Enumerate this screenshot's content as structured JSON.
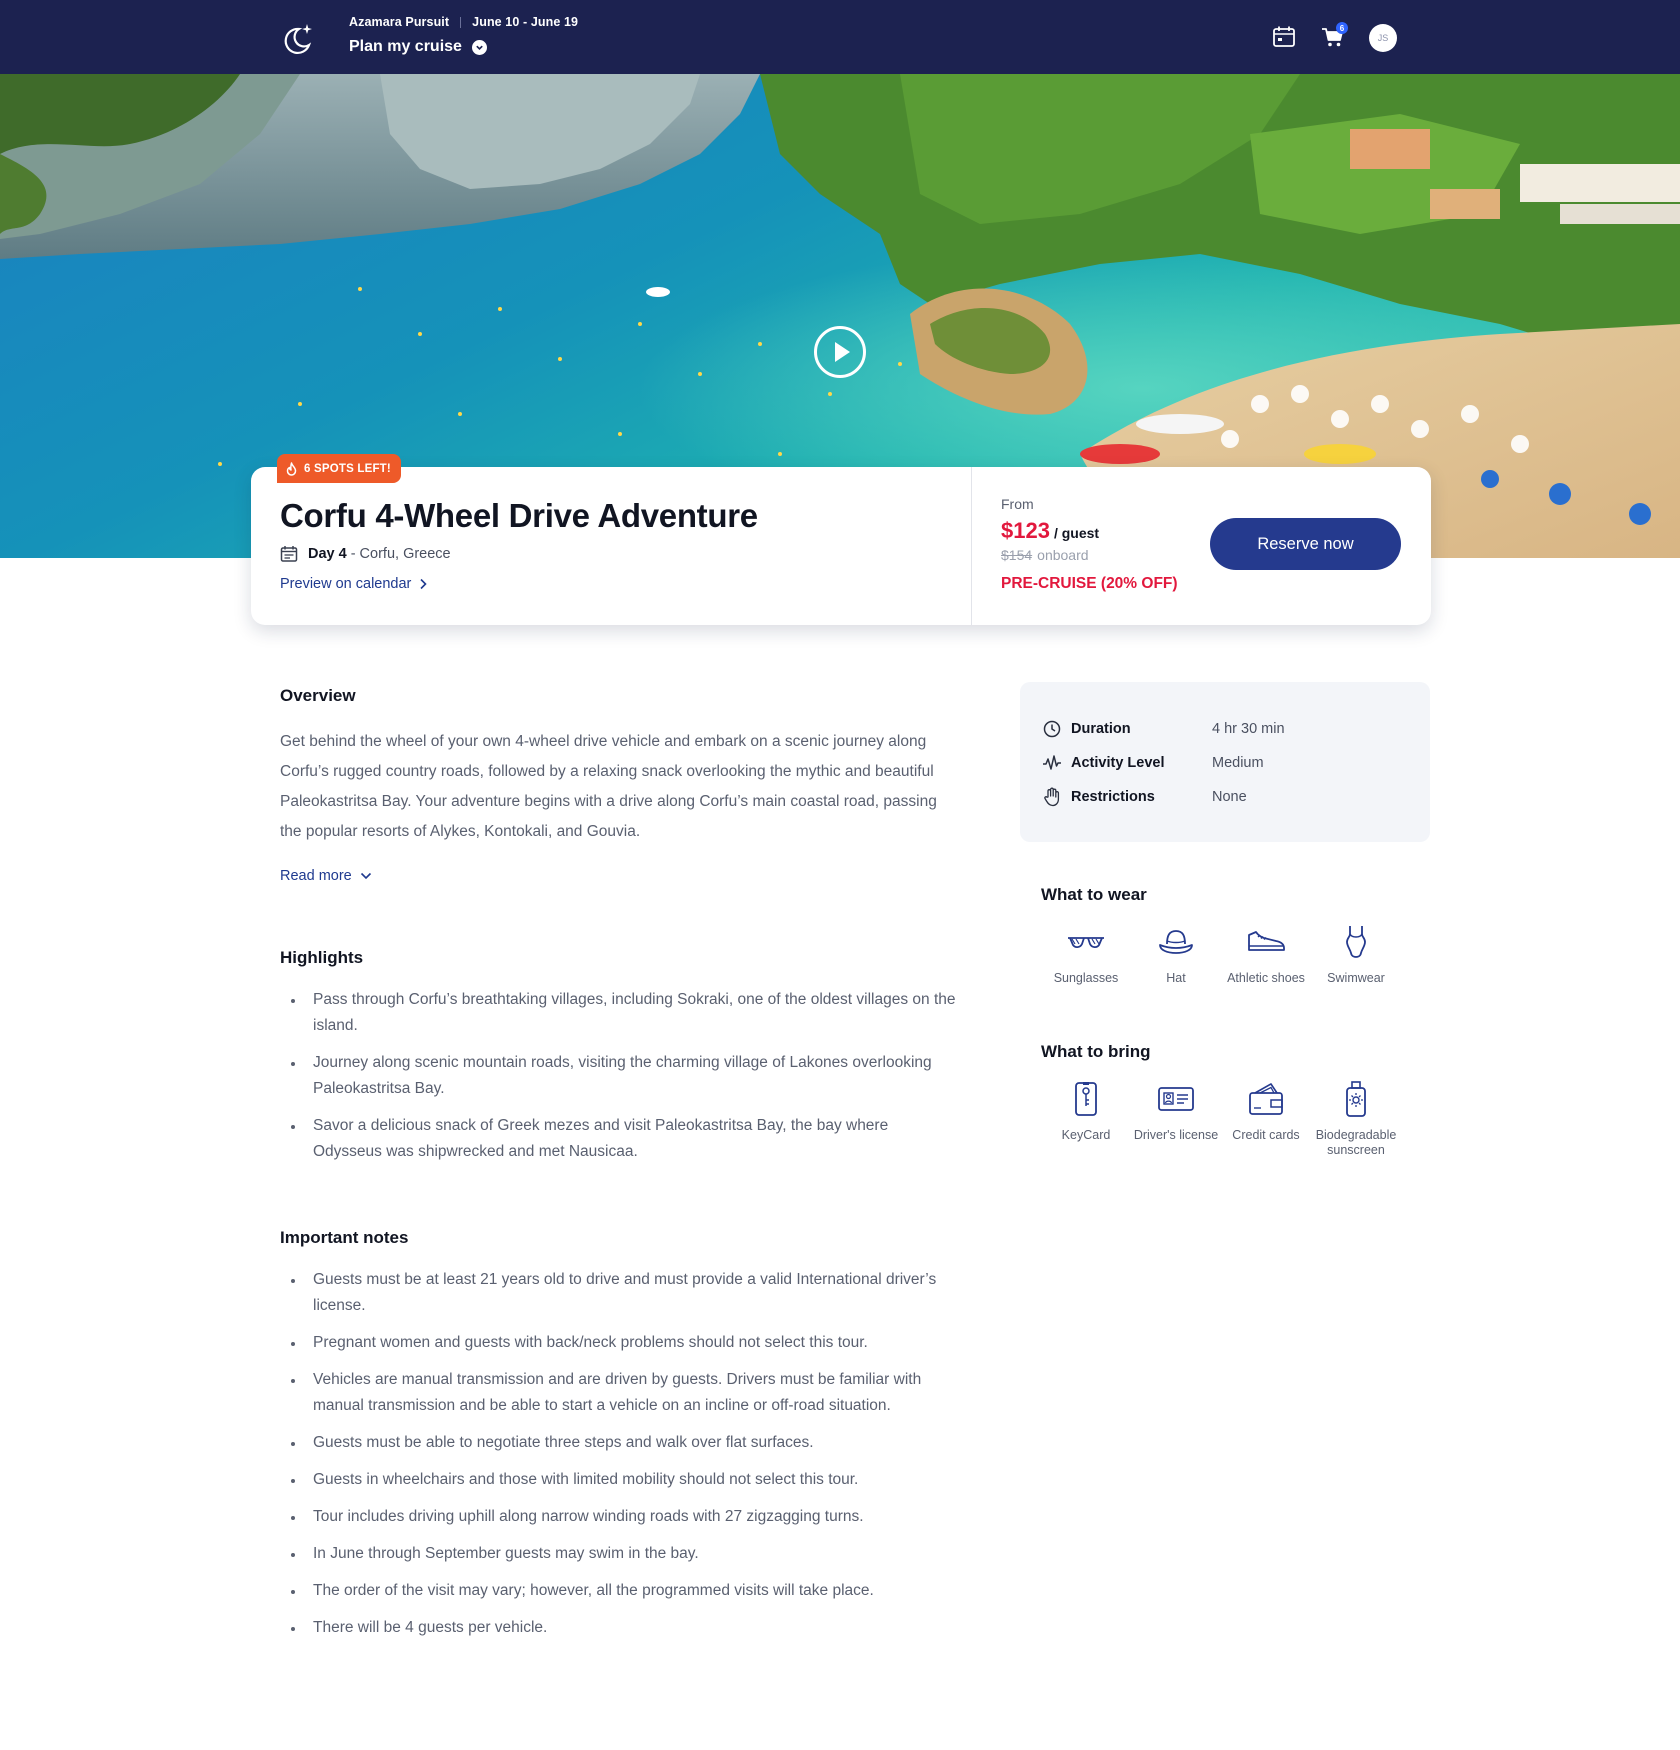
{
  "header": {
    "ship_name": "Azamara Pursuit",
    "dates": "June 10  - June 19",
    "plan_label": "Plan my cruise",
    "cart_count": "6",
    "avatar_initials": "JS",
    "bg_color": "#1c2250"
  },
  "badge": {
    "spots_left": "6 SPOTS LEFT!",
    "color": "#ee5a29"
  },
  "excursion": {
    "title": "Corfu 4-Wheel Drive Adventure",
    "day": "Day 4",
    "location": "- Corfu, Greece",
    "calendar_link": "Preview on calendar"
  },
  "pricing": {
    "from_label": "From",
    "price": "$123",
    "unit": "/ guest",
    "old_price": "$154",
    "old_price_suffix": "onboard",
    "promo": "PRE-CRUISE (20% OFF)",
    "reserve_label": "Reserve now",
    "accent_color": "#e2183d",
    "button_color": "#253a8e"
  },
  "overview": {
    "title": "Overview",
    "text": "Get behind the wheel of your own 4-wheel drive vehicle and embark on a scenic journey along Corfu’s rugged country roads, followed by a relaxing snack overlooking the mythic and beautiful Paleokastritsa Bay. Your adventure begins with a drive along Corfu’s main coastal road, passing the popular resorts of Alykes, Kontokali, and Gouvia.",
    "read_more": "Read more"
  },
  "highlights": {
    "title": "Highlights",
    "items": [
      "Pass through Corfu’s breathtaking villages, including Sokraki, one of the oldest villages on the island.",
      "Journey along scenic mountain roads, visiting the charming village of Lakones overlooking Paleokastritsa Bay.",
      "Savor a delicious snack of Greek mezes and visit Paleokastritsa Bay, the bay where Odysseus was shipwrecked and met Nausicaa."
    ]
  },
  "notes": {
    "title": "Important notes",
    "items": [
      "Guests must be at least 21 years old to drive and must provide a valid International driver’s license.",
      "Pregnant women and guests with back/neck problems should not select this tour.",
      "Vehicles are manual transmission and are driven by guests. Drivers must be familiar with manual transmission and be able to start a vehicle on an incline or off-road situation.",
      "Guests must be able to negotiate three steps and walk over flat surfaces.",
      "Guests in wheelchairs and those with limited mobility should not select this tour.",
      "Tour includes driving uphill along narrow winding roads with 27 zigzagging turns.",
      "In June through September guests may swim in the bay.",
      "The order of the visit may vary; however, all the programmed visits will take place.",
      "There will be 4 guests per vehicle."
    ]
  },
  "facts": [
    {
      "label": "Duration",
      "value": "4 hr 30 min",
      "icon": "clock-icon"
    },
    {
      "label": "Activity Level",
      "value": "Medium",
      "icon": "pulse-icon"
    },
    {
      "label": "Restrictions",
      "value": "None",
      "icon": "hand-icon"
    }
  ],
  "wear": {
    "title": "What to wear",
    "items": [
      {
        "label": "Sunglasses",
        "icon": "sunglasses-icon"
      },
      {
        "label": "Hat",
        "icon": "hat-icon"
      },
      {
        "label": "Athletic shoes",
        "icon": "sneaker-icon"
      },
      {
        "label": "Swimwear",
        "icon": "swimsuit-icon"
      }
    ]
  },
  "bring": {
    "title": "What to bring",
    "items": [
      {
        "label": "KeyCard",
        "icon": "keycard-icon"
      },
      {
        "label": "Driver's license",
        "icon": "id-card-icon"
      },
      {
        "label": "Credit cards",
        "icon": "wallet-icon"
      },
      {
        "label": "Biodegradable sunscreen",
        "icon": "sunscreen-icon"
      }
    ]
  }
}
